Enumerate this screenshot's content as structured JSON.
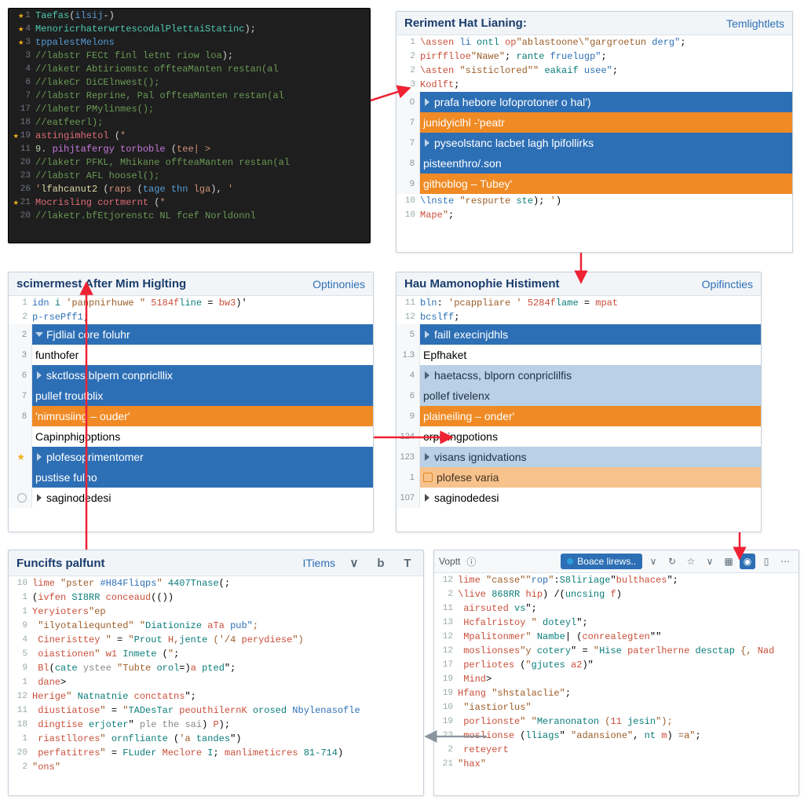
{
  "panels": {
    "p1": {
      "lines": [
        {
          "n": "1",
          "star": true,
          "html": "<span class='ty'>Taefas</span>(<span class='kw'>ilsij</span>-)"
        },
        {
          "n": "4",
          "star": true,
          "html": "<span class='ty'>MenoricrhaterwrtescodalPlettaiStatinc</span>);"
        },
        {
          "n": "3",
          "star": true,
          "html": "<span class='kw'>tppalestMelons</span>"
        },
        {
          "n": "3",
          "html": "<span class='cm'>//labstr FECt finl letnt riow loa</span>);"
        },
        {
          "n": "4",
          "html": "<span class='cm'>//laketr Abtiriomstc offteaManten restan(al</span>"
        },
        {
          "n": "6",
          "html": "<span class='cm'>//lakeCr DiCElnwest();</span>"
        },
        {
          "n": "7",
          "html": "<span class='cm'>//labstr Reprine, Pal offteaManten restan(al</span>"
        },
        {
          "n": "17",
          "html": "<span class='cm'>//lahetr PMylinmes();</span>"
        },
        {
          "n": "18",
          "html": "<span class='cm'>//eatfeerl);</span>"
        },
        {
          "n": "19",
          "star": true,
          "html": "<span class='err'>astingimhetol</span> (<span class='st'>*</span>"
        },
        {
          "n": "11",
          "html": "<span class='num'>9.</span> <span class='mac'>pihjtafergy torboble</span> (<span class='st'>tee| &gt;</span>"
        },
        {
          "n": "20",
          "html": "<span class='cm'>//laketr PFKL, Mhikane offteaManten restan(al</span>"
        },
        {
          "n": "23",
          "html": "<span class='cm'>//labstr AFL hoosel();</span>"
        },
        {
          "n": "26",
          "html": "<span class='st'>'</span><span class='fn'>lfahcanut2</span> (<span class='st'>raps</span> (<span class='kw'>tage</span> <span class='kw'>thn</span> <span class='st'>lga</span>), <span class='st'>'</span>"
        },
        {
          "n": "21",
          "star": true,
          "html": "<span class='err'>Mocrisling cortmernt</span> (<span class='st'>*</span>"
        },
        {
          "n": "20",
          "html": "<span class='cm'>//laketr.bfEtjorenstc NL fcef Norldonnl</span>"
        }
      ]
    },
    "p2": {
      "title": "Reriment Hat Lianing:",
      "link": "Temlightlets",
      "lines": [
        {
          "n": "1",
          "html": "<span class='kw-red'>\\assen</span> <span class='kw-blue'>li</span> <span class='kw-teal'>ontl</span> <span class='kw-red'>op</span><span class='kw-brown'>\"ablastoone\\\"gargroetun</span> <span class='kw-blue'>derg\"</span>;"
        },
        {
          "n": "2",
          "html": "<span class='kw-red'>pirfflloe</span><span class='kw-brown'>\"Nawe\"</span>; <span class='kw-teal'>rante</span> <span class='kw-blue'>fruelugp\"</span>;"
        },
        {
          "n": "2",
          "html": "<span class='kw-red'>\\asten</span> <span class='kw-brown'>\"sisticlored\"\"</span> <span class='kw-teal'>eakaif</span> <span class='kw-blue'>usee\"</span>;"
        },
        {
          "n": "3",
          "html": "<span class='kw-red'>Kodlft</span>;"
        }
      ],
      "rows": [
        {
          "n": "0",
          "style": "sel-blue",
          "indent": "indent1",
          "chev": true,
          "label": "prafa hebore lofoprotoner o hal')"
        },
        {
          "n": "7",
          "style": "sel-orange",
          "indent": "indent1",
          "label": "junidyiclhl -'peatr"
        },
        {
          "n": "7",
          "style": "sel-blue",
          "indent": "indent1",
          "chev": true,
          "label": "pyseolstanc lacbet lagh lpifollirks"
        },
        {
          "n": "8",
          "style": "sel-blue",
          "indent": "indent1",
          "label": "pisteenthro/.son"
        },
        {
          "n": "9",
          "style": "sel-orange",
          "indent": "indent1",
          "label": "githoblog – Tubey'"
        },
        {
          "n": "10",
          "plain": true,
          "html": "<span class='kw-blue'>\\lnste</span> <span class='kw-brown'>\"respurte</span> <span class='kw-teal'>ste</span>); <span class='kw-brown'>'</span>)"
        },
        {
          "n": "10",
          "plain": true,
          "html": "<span class='kw-red'>Mape</span><span class='kw-brown'>\"</span>;"
        }
      ]
    },
    "p3": {
      "title": "scimermest After Mim Higlting",
      "link": "Optinonies",
      "lines": [
        {
          "n": "1",
          "html": "<span class='kw-blue'>idn</span> <span class='kw-teal'>i</span> <span class='kw-brown'>'panpnirhuwe \"</span> <span class='kw-red'>5184f</span><span class='kw-teal'>line</span> = <span class='kw-red'>bw3</span>)'"
        },
        {
          "n": "2",
          "html": "<span class='kw-blue'>p-rsePff1</span>;"
        }
      ],
      "rows": [
        {
          "n": "2",
          "style": "sel-blue",
          "indent": "indent0",
          "chev": true,
          "down": true,
          "label": "Fjdlial core foluhr"
        },
        {
          "n": "3",
          "indent": "indent1",
          "label": "funthofer"
        },
        {
          "n": "6",
          "style": "sel-blue",
          "indent": "indent2",
          "chev": true,
          "label": "skctloss.blpern conpriclllix"
        },
        {
          "n": "7",
          "style": "sel-blue",
          "indent": "indent2",
          "label": "pullef troutblix"
        },
        {
          "n": "8",
          "style": "sel-orange",
          "indent": "indent2",
          "label": "'nimrusiing – ouder'"
        },
        {
          "n": "",
          "indent": "indent1",
          "label": "Capinphigoptions"
        },
        {
          "n": "",
          "star": true,
          "style": "sel-blue",
          "indent": "indent2",
          "chev": true,
          "label": "plofesoprimentomer"
        },
        {
          "n": "",
          "style": "sel-blue",
          "indent": "indent2",
          "label": "pustise fulno"
        },
        {
          "n": "",
          "mark": true,
          "indent": "indent2",
          "chev": true,
          "label": "saginodedesi"
        }
      ]
    },
    "p4": {
      "title": "Hau Mamonophie Histiment",
      "link": "Opifincties",
      "lines": [
        {
          "n": "11",
          "html": "<span class='kw-blue'>bln</span>: <span class='kw-brown'>'pcappliare '</span> <span class='kw-red'>5284f</span><span class='kw-teal'>lame</span> = <span class='kw-red'>mpat</span>"
        },
        {
          "n": "12",
          "html": "<span class='kw-blue'>bcslff</span>;"
        }
      ],
      "rows": [
        {
          "n": "5",
          "style": "sel-blue",
          "indent": "indent0",
          "chev": true,
          "label": "faill execinjdhls"
        },
        {
          "n": "1.3",
          "indent": "indent1",
          "label": "Epfhaket"
        },
        {
          "n": "4",
          "style": "sel-lblue",
          "indent": "indent2",
          "chev": true,
          "label": "haetacss, blporn conpriclilfis"
        },
        {
          "n": "6",
          "style": "sel-lblue",
          "indent": "indent2",
          "label": "pollef tivelenx"
        },
        {
          "n": "9",
          "style": "sel-orange",
          "indent": "indent2",
          "label": "plaineiling – onder'"
        },
        {
          "n": "124",
          "indent": "indent2",
          "label": "orpiningpotions"
        },
        {
          "n": "123",
          "style": "sel-lblue",
          "indent": "indent2",
          "chev": true,
          "label": "visans ignidvations"
        },
        {
          "n": "1",
          "style": "sel-lorange",
          "indent": "indent2",
          "icon": true,
          "label": "plofese varia"
        },
        {
          "n": "107",
          "indent": "indent2",
          "chev": true,
          "label": "saginodedesi"
        }
      ]
    },
    "p5": {
      "title": "Funcifts palfunt",
      "link": "ITiems",
      "toolbar": [
        "∨",
        "b",
        "T"
      ],
      "lines": [
        {
          "n": "10",
          "html": "<span class='kw-red'>lime</span> <span class='kw-brown'>\"pster <span class='kw-blue'>#H84Fliqps</span>\"</span> <span class='kw-teal'>4407Tnase</span>(;"
        },
        {
          "n": "1",
          "html": "(<span class='kw-red'>ivfen</span> <span class='kw-teal'>SI8RR</span> <span class='kw-red'>conceaud</span>(())"
        },
        {
          "n": "1",
          "html": "<span class='kw-red'>Yeryioters</span><span class='kw-brown'>\"ep</span>"
        },
        {
          "n": "9",
          "html": " <span class='kw-brown'>\"ilyotaliequnted\"</span> <span class='kw-brown'>\"<span class='kw-teal'>Diationize</span> <span class='kw-red'>aTa</span> <span class='kw-blue'>pub\"</span>;"
        },
        {
          "n": "4",
          "html": " <span class='kw-red'>Cineristtey</span> <span class='kw-brown'>\"</span> = <span class='kw-brown'>\"<span class='kw-teal'>Prout</span> <span class='kw-red'>H</span>,<span class='kw-teal'>jente</span> (<span class='kw-brown'>'/4</span> <span class='kw-red'>perydiese</span>\")"
        },
        {
          "n": "5",
          "html": " <span class='kw-red'>oiastionen</span><span class='kw-brown'>\"</span> <span class='kw-red'>w1</span> <span class='kw-teal'>Inmete</span> (<span class='kw-brown'>\"</span>;"
        },
        {
          "n": "9",
          "html": " <span class='kw-red'>Bl</span>(<span class='kw-teal'>cate</span> <span class='kw-gray'>ystee</span> <span class='kw-brown'>\"Tubte</span> <span class='kw-teal'>orol</span>=)<span class='kw-red'>a</span> <span class='kw-teal'>pted</span>\";"
        },
        {
          "n": "1",
          "html": " <span class='kw-red'>dane</span>&gt;"
        },
        {
          "n": "12",
          "html": "<span class='kw-red'>Herige</span><span class='kw-brown'>\"</span> <span class='kw-teal'>Natnatnie</span> <span class='kw-red'>conctatns</span>\";"
        },
        {
          "n": "11",
          "html": " <span class='kw-red'>diustiatose</span><span class='kw-brown'>\"</span> = <span class='kw-brown'>\"<span class='kw-teal'>TADesTar</span> <span class='kw-red'>peouthilernK</span> <span class='kw-teal'>orosed</span> <span class='kw-blue'>Nbylenasofle</span>"
        },
        {
          "n": "18",
          "html": " <span class='kw-red'>dingtise</span> <span class='kw-teal'>erjoter</span>\" <span class='kw-gray'>ple the sai</span>) <span class='kw-red'>P</span>);"
        },
        {
          "n": "1",
          "html": " <span class='kw-red'>riastllores</span><span class='kw-brown'>\"</span> <span class='kw-teal'>ornfliante</span> (<span class='kw-brown'>'a</span> <span class='kw-teal'>tandes</span>\")"
        },
        {
          "n": "20",
          "html": " <span class='kw-red'>perfatitres</span><span class='kw-brown'>\"</span> = <span class='kw-teal'>FLuder</span> <span class='kw-red'>Meclore</span> <span class='kw-teal'>I</span>; <span class='kw-red'>manlimeticres</span> <span class='kw-teal'>81-714</span>)"
        },
        {
          "n": "2",
          "html": "<span class='kw-brown'>\"</span><span class='kw-red'>ons</span><span class='kw-brown'>\"</span>"
        }
      ]
    },
    "p6": {
      "tab": "Boace lirews..",
      "toolbar_left": [
        "Voptt",
        "ⓘ"
      ],
      "lines": [
        {
          "n": "12",
          "html": "<span class='kw-red'>lime</span> <span class='kw-brown'>\"casse\"\"<span class='kw-blue'>rop</span>\"</span>:<span class='kw-teal'>S8liriage</span>\"<span class='kw-red'>bulthaces</span>\";"
        },
        {
          "n": "2",
          "html": "<span class='kw-red'>\\live</span> <span class='kw-teal'>868RR</span> <span class='kw-red'>hip</span>) /(<span class='kw-teal'>uncsing</span> <span class='kw-red'>f</span>)"
        },
        {
          "n": "11",
          "html": " <span class='kw-red'>airsuted</span> <span class='kw-teal'>vs</span>\";"
        },
        {
          "n": "13",
          "html": " <span class='kw-red'>Hcfalristoy</span> <span class='kw-brown'>\"</span> <span class='kw-teal'>doteyl</span>\";"
        },
        {
          "n": "12",
          "html": " <span class='kw-red'>Mpalitonmer</span><span class='kw-brown'>\"</span> <span class='kw-teal'>Nambe</span>| (<span class='kw-red'>conrealegten</span>\"\""
        },
        {
          "n": "12",
          "html": " <span class='kw-red'>moslionses</span><span class='kw-brown'>\"y</span> <span class='kw-teal'>cotery</span>\" = <span class='kw-brown'>\"<span class='kw-teal'>Hise</span> <span class='kw-red'>paterlherne</span> <span class='kw-teal'>desctap</span> {, <span class='kw-red'>Nad</span>"
        },
        {
          "n": "17",
          "html": " <span class='kw-red'>perliotes</span> (<span class='kw-brown'>\"</span><span class='kw-teal'>gjutes</span> <span class='kw-red'>a2</span>)\""
        },
        {
          "n": "19",
          "html": " <span class='kw-red'>Mind</span>&gt;"
        },
        {
          "n": "19",
          "html": "<span class='kw-red'>Hfang</span> <span class='kw-brown'>\"shstalaclie\"</span>;"
        },
        {
          "n": "10",
          "html": " <span class='kw-brown'>\"iastiorlus\"</span>"
        },
        {
          "n": "19",
          "html": " <span class='kw-red'>porlionste</span><span class='kw-brown'>\"</span> <span class='kw-brown'>\"<span class='kw-teal'>Meranonaton</span> (<span class='kw-red'>11</span> <span class='kw-teal'>jesin</span>\");"
        },
        {
          "n": "23",
          "html": " <span class='kw-red'>moslionse</span> (<span class='kw-teal'>lliags</span>\" <span class='kw-brown'>\"adansione\"</span>, <span class='kw-teal'>nt</span> <span class='kw-red'>m</span>) <span class='kw-brown'>=a\"</span>;"
        },
        {
          "n": "2",
          "html": " <span class='kw-red'>reteyert</span>"
        },
        {
          "n": "21",
          "html": "<span class='kw-brown'>\"</span><span class='kw-red'>hax</span><span class='kw-brown'>\"</span>"
        }
      ]
    }
  }
}
